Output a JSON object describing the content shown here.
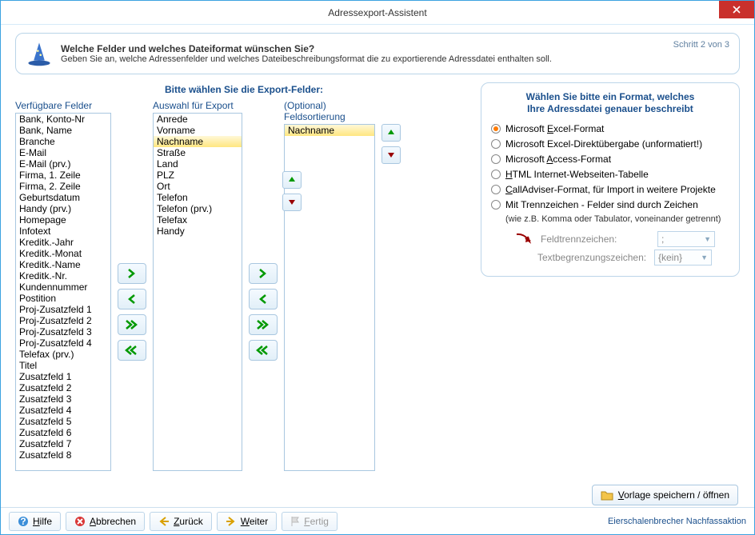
{
  "window": {
    "title": "Adressexport-Assistent",
    "step": "Schritt 2 von 3"
  },
  "header": {
    "line1": "Welche Felder und welches Dateiformat wünschen Sie?",
    "line2": "Geben Sie an, welche Adressenfelder und welches Dateibeschreibungsformat die zu exportierende Adressdatei enthalten soll."
  },
  "headings": {
    "main": "Bitte wählen Sie die Export-Felder:",
    "available": "Verfügbare Felder",
    "selected": "Auswahl für Export",
    "sort_opt": "(Optional)",
    "sort": "Feldsortierung"
  },
  "available_fields": [
    "Bank, Konto-Nr",
    "Bank, Name",
    "Branche",
    "E-Mail",
    "E-Mail (prv.)",
    "Firma, 1. Zeile",
    "Firma, 2. Zeile",
    "Geburtsdatum",
    "Handy (prv.)",
    "Homepage",
    "Infotext",
    "Kreditk.-Jahr",
    "Kreditk.-Monat",
    "Kreditk.-Name",
    "Kreditk.-Nr.",
    "Kundennummer",
    "Postition",
    "Proj-Zusatzfeld 1",
    "Proj-Zusatzfeld 2",
    "Proj-Zusatzfeld 3",
    "Proj-Zusatzfeld 4",
    "Telefax (prv.)",
    "Titel",
    "Zusatzfeld 1",
    "Zusatzfeld 2",
    "Zusatzfeld 3",
    "Zusatzfeld 4",
    "Zusatzfeld 5",
    "Zusatzfeld 6",
    "Zusatzfeld 7",
    "Zusatzfeld 8"
  ],
  "export_fields": [
    "Anrede",
    "Vorname",
    "Nachname",
    "Straße",
    "Land",
    "PLZ",
    "Ort",
    "Telefon",
    "Telefon (prv.)",
    "Telefax",
    "Handy"
  ],
  "export_selected_index": 2,
  "sort_fields": [
    "Nachname"
  ],
  "sort_selected_index": 0,
  "format": {
    "heading1": "Wählen Sie bitte ein Format, welches",
    "heading2": "Ihre Adressdatei genauer beschreibt",
    "options": [
      "Microsoft Excel-Format",
      "Microsoft Excel-Direktübergabe (unformatiert!)",
      "Microsoft Access-Format",
      "HTML Internet-Webseiten-Tabelle",
      "CallAdviser-Format, für Import in weitere Projekte",
      "Mit Trennzeichen - Felder sind durch Zeichen"
    ],
    "selected": 0,
    "separator_note": "(wie z.B. Komma oder Tabulator, voneinander getrennt)",
    "field_sep_label": "Feldtrennzeichen:",
    "field_sep_value": ";",
    "text_delim_label": "Textbegrenzungszeichen:",
    "text_delim_value": "{kein}"
  },
  "buttons": {
    "save_template": "Vorlage speichern / öffnen",
    "help": "Hilfe",
    "cancel": "Abbrechen",
    "back": "Zurück",
    "next": "Weiter",
    "finish": "Fertig"
  },
  "status": "Eierschalenbrecher Nachfassaktion"
}
